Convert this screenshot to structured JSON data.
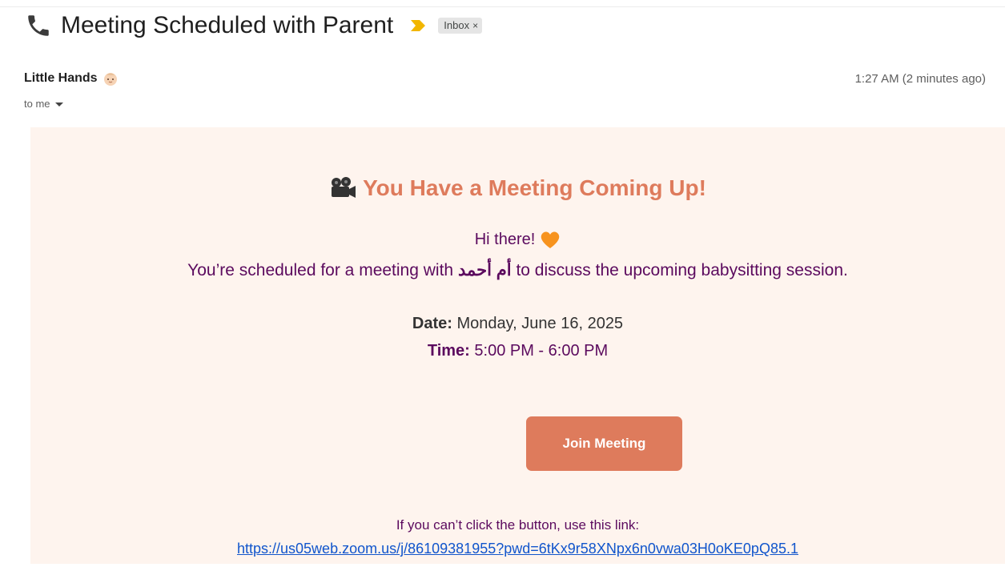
{
  "email": {
    "subject": "Meeting Scheduled with Parent",
    "label": "Inbox",
    "label_remove": "×",
    "sender_name": "Little Hands",
    "timestamp": "1:27 AM (2 minutes ago)",
    "recipient": "to me"
  },
  "body": {
    "heading": "You Have a Meeting Coming Up!",
    "greeting": "Hi there!",
    "intro_before": "You’re scheduled for a meeting with",
    "parent_name": "أم أحمد",
    "intro_after": "to discuss the upcoming babysitting session.",
    "date_label": "Date:",
    "date_value": "Monday, June 16, 2025",
    "time_label": "Time:",
    "time_value": "5:00 PM - 6:00 PM",
    "button_label": "Join Meeting",
    "fallback_text": "If you can’t click the button, use this link:",
    "link_url": "https://us05web.zoom.us/j/86109381955?pwd=6tKx9r58XNpx6n0vwa03H0oKE0pQ85.1"
  },
  "icons": {
    "subject_icon": "phone-icon",
    "importance_icon": "importance-marker-icon",
    "sender_icon": "baby-icon",
    "heading_icon": "movie-camera-icon",
    "greeting_icon": "heart-icon"
  },
  "colors": {
    "accent": "#de7b5c",
    "text_purple": "#5b0a5e",
    "body_bg": "#fef4ee",
    "link": "#1155cc",
    "importance": "#f2b600"
  }
}
